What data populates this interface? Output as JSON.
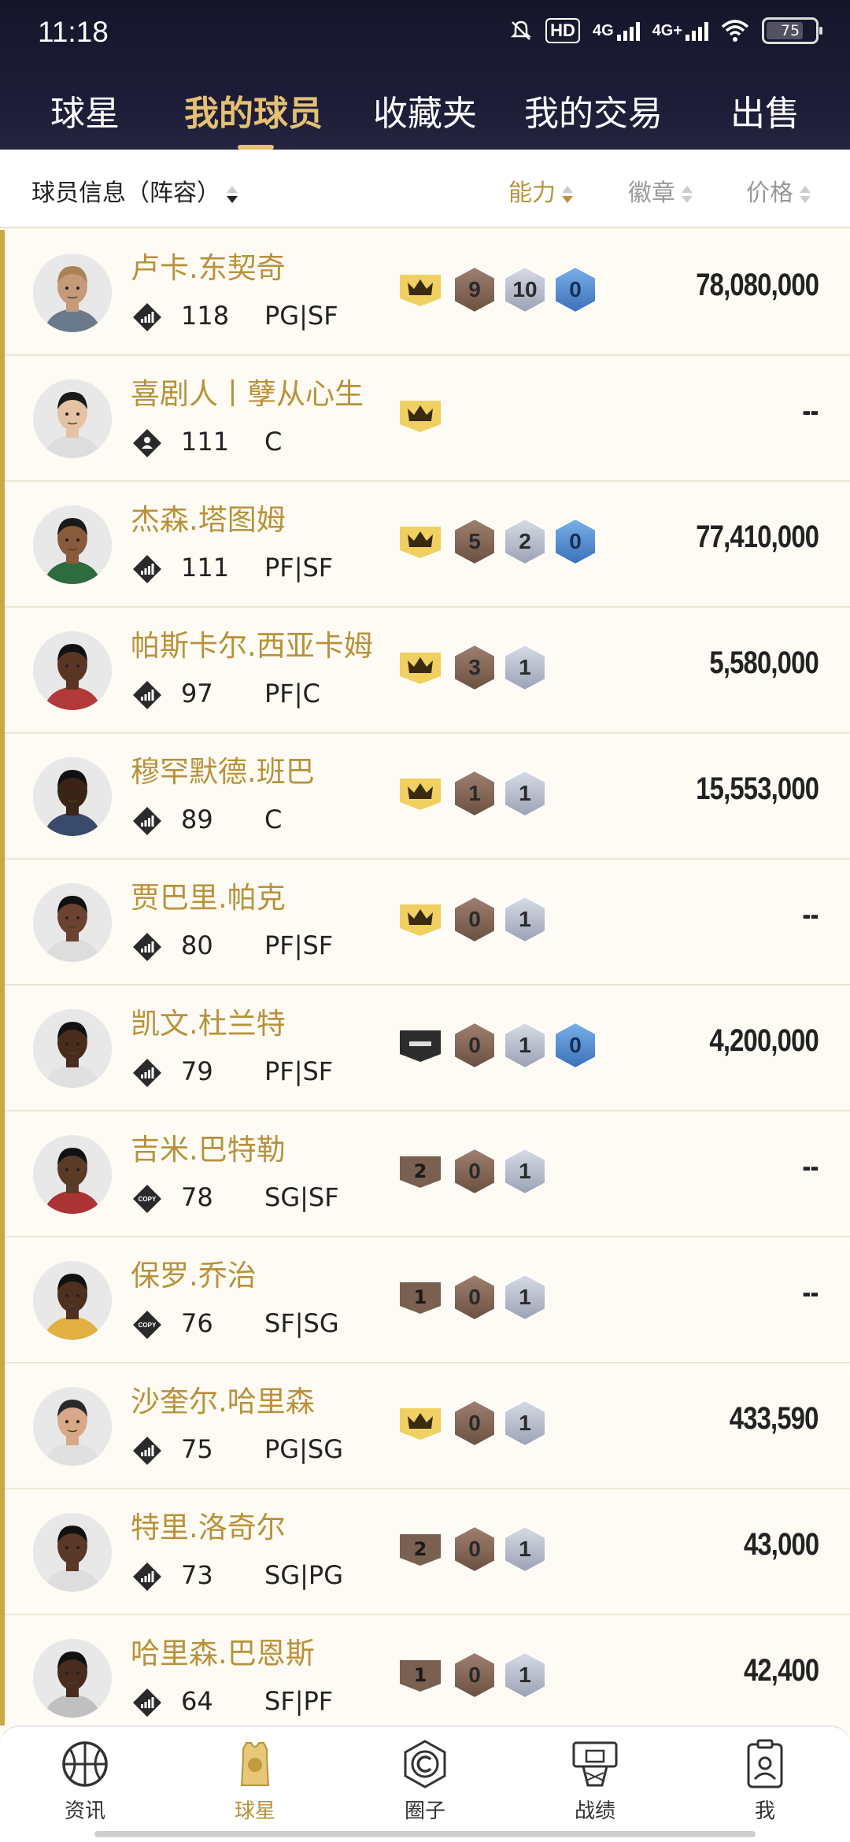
{
  "status_bar": {
    "time": "11:18",
    "hd": "HD",
    "net1": "4G",
    "net2": "4G+",
    "battery": "75"
  },
  "tabs": [
    {
      "label": "球星",
      "active": false
    },
    {
      "label": "我的球员",
      "active": true
    },
    {
      "label": "收藏夹",
      "active": false
    },
    {
      "label": "我的交易",
      "active": false
    },
    {
      "label": "出售",
      "active": false
    }
  ],
  "sortbar": {
    "title": "球员信息（阵容）",
    "ability": "能力",
    "badges": "徽章",
    "price": "价格"
  },
  "players": [
    {
      "name": "卢卡.东契奇",
      "rating": "118",
      "position": "PG|SF",
      "tier": "crown",
      "b1": "9",
      "b2": "10",
      "b3": "0",
      "price": "78,080,000",
      "stat": "bars"
    },
    {
      "name": "喜剧人丨孽从心生",
      "rating": "111",
      "position": "C",
      "tier": "crown",
      "b1": "",
      "b2": "",
      "b3": "",
      "price": "--",
      "stat": "person"
    },
    {
      "name": "杰森.塔图姆",
      "rating": "111",
      "position": "PF|SF",
      "tier": "crown",
      "b1": "5",
      "b2": "2",
      "b3": "0",
      "price": "77,410,000",
      "stat": "bars"
    },
    {
      "name": "帕斯卡尔.西亚卡姆",
      "rating": "97",
      "position": "PF|C",
      "tier": "crown",
      "b1": "3",
      "b2": "1",
      "b3": "",
      "price": "5,580,000",
      "stat": "bars"
    },
    {
      "name": "穆罕默德.班巴",
      "rating": "89",
      "position": "C",
      "tier": "crown",
      "b1": "1",
      "b2": "1",
      "b3": "",
      "price": "15,553,000",
      "stat": "bars"
    },
    {
      "name": "贾巴里.帕克",
      "rating": "80",
      "position": "PF|SF",
      "tier": "crown",
      "b1": "0",
      "b2": "1",
      "b3": "",
      "price": "--",
      "stat": "bars"
    },
    {
      "name": "凯文.杜兰特",
      "rating": "79",
      "position": "PF|SF",
      "tier": "dark",
      "b1": "0",
      "b2": "1",
      "b3": "0",
      "price": "4,200,000",
      "stat": "bars"
    },
    {
      "name": "吉米.巴特勒",
      "rating": "78",
      "position": "SG|SF",
      "tier": "2",
      "b1": "0",
      "b2": "1",
      "b3": "",
      "price": "--",
      "stat": "copy"
    },
    {
      "name": "保罗.乔治",
      "rating": "76",
      "position": "SF|SG",
      "tier": "1",
      "b1": "0",
      "b2": "1",
      "b3": "",
      "price": "--",
      "stat": "copy"
    },
    {
      "name": "沙奎尔.哈里森",
      "rating": "75",
      "position": "PG|SG",
      "tier": "crown",
      "b1": "0",
      "b2": "1",
      "b3": "",
      "price": "433,590",
      "stat": "bars"
    },
    {
      "name": "特里.洛奇尔",
      "rating": "73",
      "position": "SG|PG",
      "tier": "2",
      "b1": "0",
      "b2": "1",
      "b3": "",
      "price": "43,000",
      "stat": "bars"
    },
    {
      "name": "哈里森.巴恩斯",
      "rating": "64",
      "position": "SF|PF",
      "tier": "1",
      "b1": "0",
      "b2": "1",
      "b3": "",
      "price": "42,400",
      "stat": "bars"
    }
  ],
  "bottom_nav": [
    {
      "label": "资讯",
      "icon": "basketball-icon",
      "active": false
    },
    {
      "label": "球星",
      "icon": "player-jersey-icon",
      "active": true
    },
    {
      "label": "圈子",
      "icon": "circle-c-icon",
      "active": false
    },
    {
      "label": "战绩",
      "icon": "hoop-icon",
      "active": false
    },
    {
      "label": "我",
      "icon": "profile-card-icon",
      "active": false
    }
  ],
  "colors": {
    "accent_gold": "#b8923a",
    "header_bg": "#1a1a33",
    "tab_active": "#e4c072",
    "list_bg": "#fdfbf4",
    "badge_bronze": "#8a7060",
    "badge_silver": "#a8b0c0",
    "badge_blue": "#4a80c0",
    "crown_yellow": "#f0d060"
  }
}
